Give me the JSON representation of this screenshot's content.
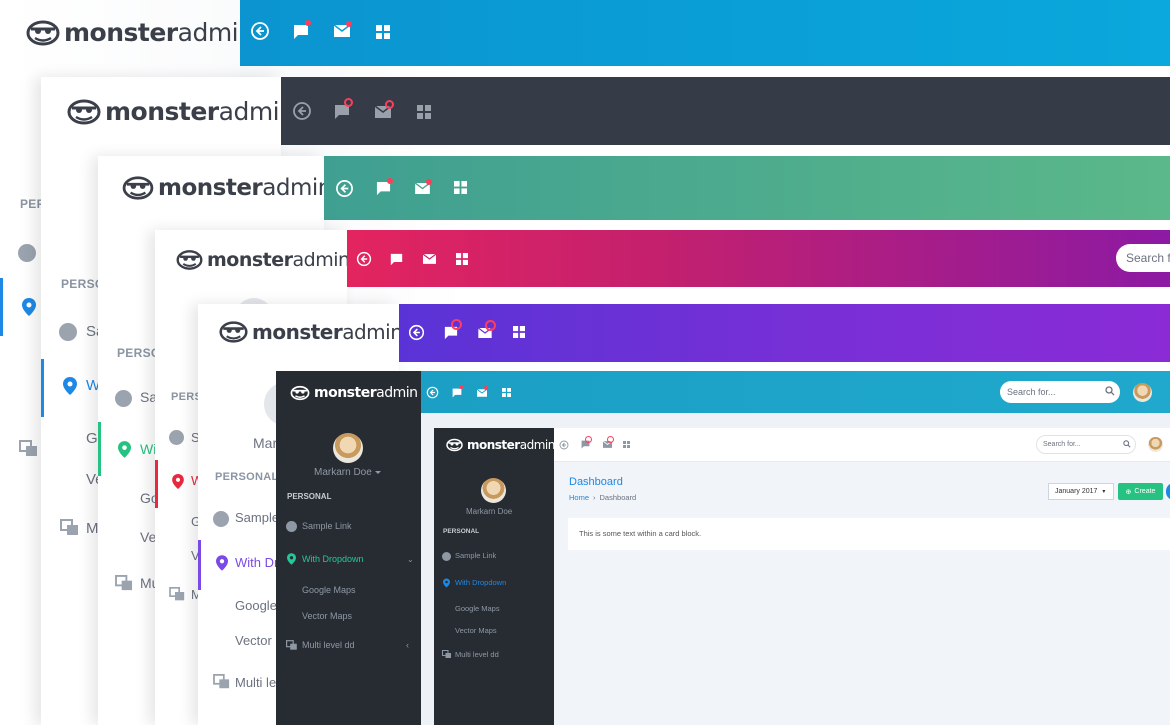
{
  "brand": {
    "bold": "monster",
    "light": "admin"
  },
  "colors": {
    "bar1": "#0aa0d8",
    "bar2": "#363b48",
    "bar3": "#4fae8c",
    "bar4_start": "#e3245f",
    "bar4_end": "#8c1aa3",
    "bar5_start": "#5a33d6",
    "bar5_end": "#8a2bd6",
    "bar6": "#1aa6c8",
    "accent_blue": "#1e88e5",
    "accent_green": "#26c281",
    "accent_red": "#e8283f",
    "accent_purple": "#7b4ae6",
    "accent_teal": "#20c997",
    "dark_sidebar": "#272c33"
  },
  "nav": {
    "personal_short": "PERS",
    "personal_mid": "PERSO",
    "personal": "PERSONAL",
    "sample_short": "Sa",
    "sample_tiny": "S",
    "sample_mid": "Sample",
    "sample": "Sample Link",
    "with_short": "W",
    "with_mid": "Wi",
    "with_drop": "With Dr",
    "with_dropdown": "With Dropdown",
    "google_short": "Go",
    "google_tiny": "G",
    "google": "Google",
    "google_maps": "Google Maps",
    "vector_short": "Ve",
    "vector_tiny": "V",
    "vector": "Vector",
    "vector_maps": "Vector Maps",
    "multi_short": "M",
    "multi_mid": "Mu",
    "multi_lev": "Multi lev",
    "multi_level": "Multi level dd",
    "mar": "Mar"
  },
  "header": {
    "search_partial": "Search fo",
    "search_placeholder": "Search for...",
    "user_name": "Markarn Doe"
  },
  "inner": {
    "page_title": "Dashboard",
    "breadcrumb_home": "Home",
    "breadcrumb_current": "Dashboard",
    "date_select": "January 2017",
    "create_button": "Create",
    "card_text": "This is some text within a card block."
  }
}
